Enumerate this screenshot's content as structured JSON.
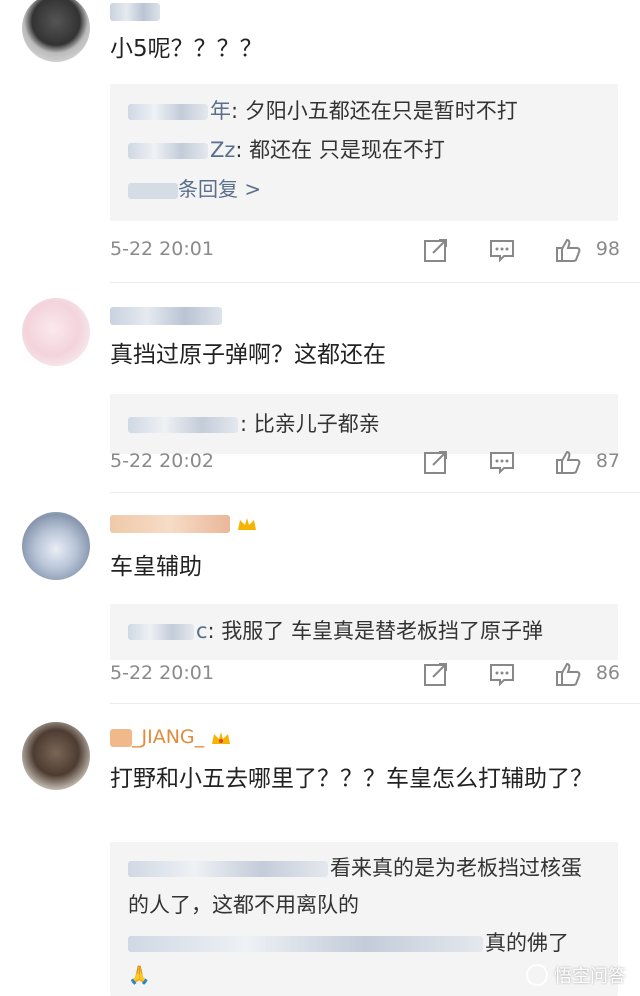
{
  "comments": [
    {
      "username": "",
      "text": "小5呢？？？？",
      "replies": [
        {
          "name": "年",
          "text": ": 夕阳小五都还在只是暂时不打"
        },
        {
          "name": "Zz",
          "text": ": 都还在 只是现在不打"
        }
      ],
      "more": "条回复 >",
      "time": "5-22 20:01",
      "likes": "98"
    },
    {
      "username": "",
      "text": "真挡过原子弹啊？这都还在",
      "replies": [
        {
          "name": "",
          "text": ": 比亲儿子都亲"
        }
      ],
      "time": "5-22 20:02",
      "likes": "87"
    },
    {
      "username": "",
      "text": "车皇辅助",
      "replies": [
        {
          "name": "c",
          "text": ": 我服了 车皇真是替老板挡了原子弹"
        }
      ],
      "time": "5-22 20:01",
      "likes": "86"
    },
    {
      "username": "_JIANG_",
      "text": "打野和小五去哪里了？？？车皇怎么打辅助了？",
      "replies": [
        {
          "name": "",
          "text": "看来真的是为老板挡过核蛋的人了，这都不用离队的"
        },
        {
          "name": "",
          "text": "真的佛了"
        }
      ]
    }
  ],
  "watermark": "悟空问答",
  "colors": {
    "name": "#5b6e8c",
    "meta": "#8a8a8a",
    "reply_bg": "#f4f4f4"
  }
}
